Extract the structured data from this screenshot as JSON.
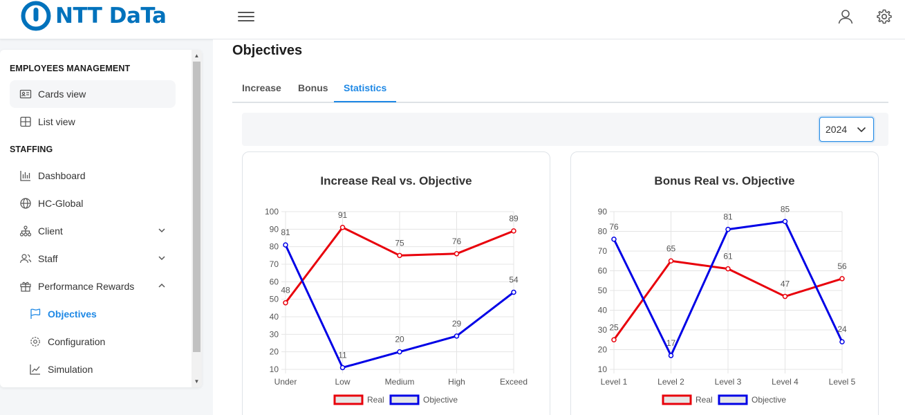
{
  "header": {
    "logo_text": "NTT DaTa",
    "brand_color": "#0072bc",
    "menu_icon": "hamburger-icon",
    "user_icon": "user-icon",
    "settings_icon": "gear-icon"
  },
  "sidebar": {
    "sections": [
      {
        "title": "EMPLOYEES MANAGEMENT"
      },
      {
        "title": "STAFFING"
      }
    ],
    "items": [
      {
        "label": "Cards view",
        "icon": "id-card-icon"
      },
      {
        "label": "List view",
        "icon": "table-icon"
      },
      {
        "label": "Dashboard",
        "icon": "bar-chart-icon"
      },
      {
        "label": "HC-Global",
        "icon": "globe-icon"
      },
      {
        "label": "Client",
        "icon": "org-chart-icon"
      },
      {
        "label": "Staff",
        "icon": "users-icon"
      },
      {
        "label": "Performance Rewards",
        "icon": "gift-icon"
      },
      {
        "label": "Objectives",
        "icon": "flag-icon"
      },
      {
        "label": "Configuration",
        "icon": "gear-icon"
      },
      {
        "label": "Simulation",
        "icon": "trend-icon"
      }
    ]
  },
  "main": {
    "title": "Objectives",
    "tabs": [
      {
        "label": "Increase"
      },
      {
        "label": "Bonus"
      },
      {
        "label": "Statistics"
      }
    ],
    "active_tab": "Statistics",
    "year_select": {
      "value": "2024"
    }
  },
  "chart_data": [
    {
      "type": "line",
      "title": "Increase Real vs. Objective",
      "categories": [
        "Under",
        "Low",
        "Medium",
        "High",
        "Exceed"
      ],
      "ylim": [
        10,
        100
      ],
      "yticks": [
        10,
        20,
        30,
        40,
        50,
        60,
        70,
        80,
        90,
        100
      ],
      "grid": true,
      "legend": "bottom",
      "series": [
        {
          "name": "Real",
          "color": "#e8000b",
          "values": [
            48,
            91,
            75,
            76,
            89
          ]
        },
        {
          "name": "Objective",
          "color": "#0000e6",
          "values": [
            81,
            11,
            20,
            29,
            54
          ]
        }
      ]
    },
    {
      "type": "line",
      "title": "Bonus Real vs. Objective",
      "categories": [
        "Level 1",
        "Level 2",
        "Level 3",
        "Level 4",
        "Level 5"
      ],
      "ylim": [
        10,
        90
      ],
      "yticks": [
        10,
        20,
        30,
        40,
        50,
        60,
        70,
        80,
        90
      ],
      "grid": true,
      "legend": "bottom",
      "series": [
        {
          "name": "Real",
          "color": "#e8000b",
          "values": [
            25,
            65,
            61,
            47,
            56
          ]
        },
        {
          "name": "Objective",
          "color": "#0000e6",
          "values": [
            76,
            17,
            81,
            85,
            24
          ]
        }
      ]
    }
  ]
}
